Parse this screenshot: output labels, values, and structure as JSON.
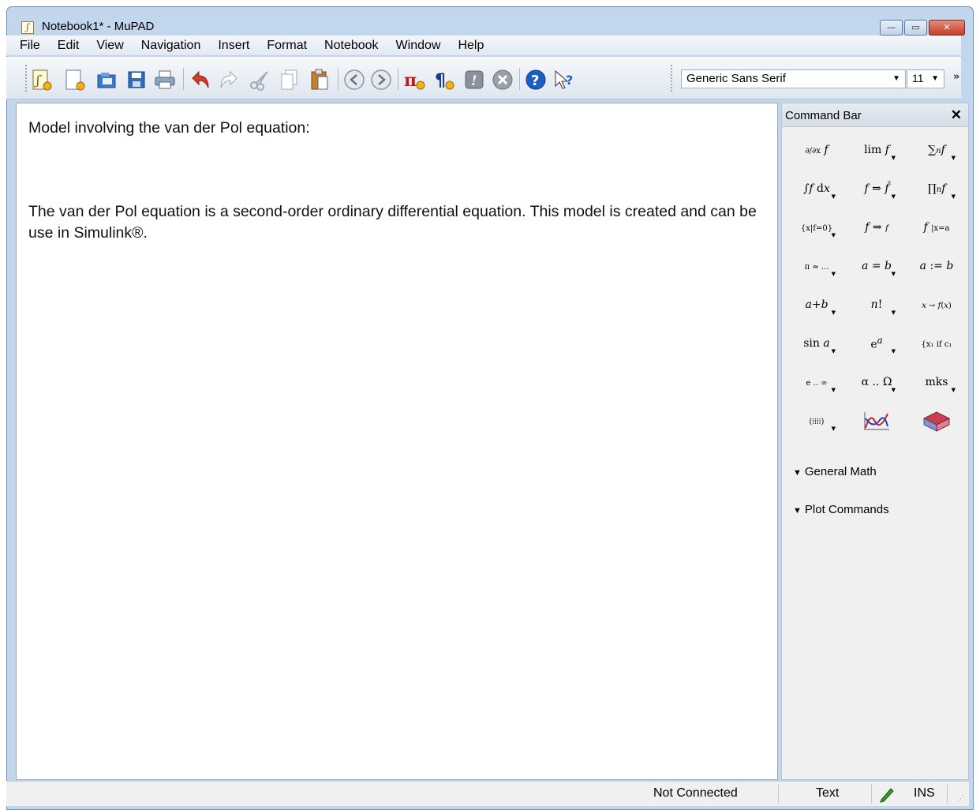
{
  "window": {
    "title": "Notebook1* - MuPAD",
    "app_icon": "mupad-icon",
    "buttons": {
      "minimize": "minimize-icon",
      "maximize": "maximize-icon",
      "close": "close-icon"
    }
  },
  "menu": [
    "File",
    "Edit",
    "View",
    "Navigation",
    "Insert",
    "Format",
    "Notebook",
    "Window",
    "Help"
  ],
  "toolbar": {
    "font_family": "Generic Sans Serif",
    "font_size": "11",
    "icons": [
      "new-notebook-icon",
      "new-editor-icon",
      "open-icon",
      "save-icon",
      "print-icon",
      "undo-icon",
      "redo-icon",
      "cut-icon",
      "copy-icon",
      "paste-icon",
      "back-icon",
      "forward-icon",
      "insert-calculation-icon",
      "insert-text-icon",
      "evaluate-icon",
      "stop-icon",
      "help-icon",
      "context-help-icon"
    ]
  },
  "document": {
    "paragraphs": [
      "Model involving the van der Pol equation:",
      "The van der Pol equation is a second-order ordinary differential equation. This model is created and can be use in Simulink®."
    ]
  },
  "command_bar": {
    "title": "Command Bar",
    "sections": [
      "General Math",
      "Plot Commands"
    ]
  },
  "status": {
    "connection": "Not Connected",
    "mode": "Text",
    "insert": "INS"
  }
}
